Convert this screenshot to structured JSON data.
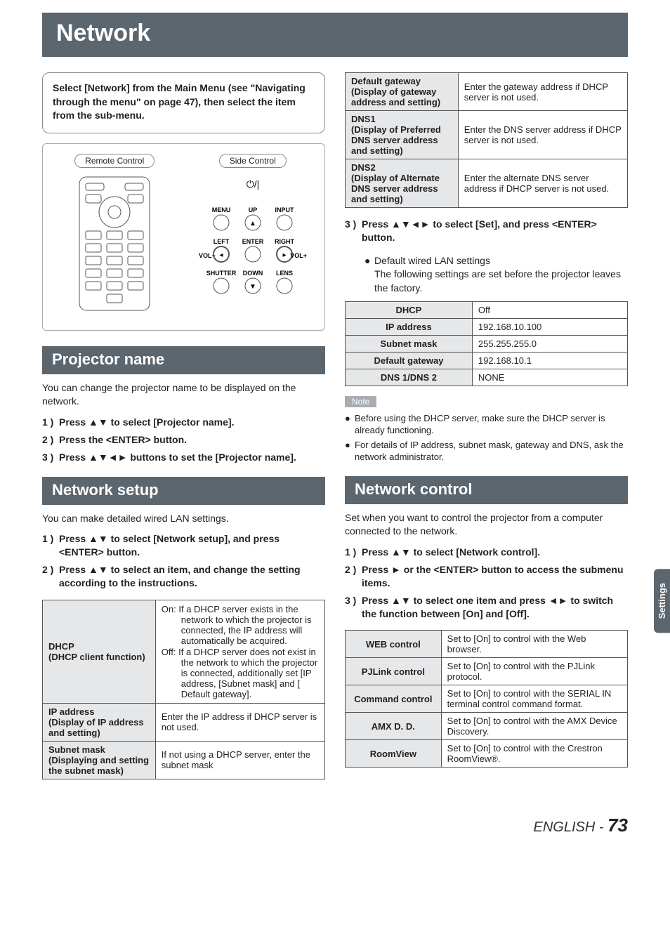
{
  "title": "Network",
  "intro": "Select [Network] from the Main Menu (see \"Navigating through the menu\" on page 47), then select the item from the sub-menu.",
  "diagram": {
    "remote_label": "Remote Control",
    "side_label": "Side Control",
    "side_buttons": [
      "MENU",
      "UP",
      "INPUT",
      "LEFT",
      "ENTER",
      "RIGHT",
      "SHUTTER",
      "DOWN",
      "LENS"
    ],
    "vol_minus": "VOL−",
    "vol_plus": "VOL+",
    "power_icon": "power-standby-icon"
  },
  "sections": {
    "projector_name": {
      "heading": "Projector name",
      "text": "You can change the projector name to be displayed on the network.",
      "steps": [
        "Press ▲▼ to select [Projector name].",
        "Press the <ENTER> button.",
        "Press ▲▼◄► buttons to set the [Projector name]."
      ]
    },
    "network_setup": {
      "heading": "Network setup",
      "text": "You can make detailed wired LAN settings.",
      "steps": [
        "Press ▲▼ to select [Network setup], and press <ENTER> button.",
        "Press ▲▼ to select an item, and change the setting according to the instructions."
      ],
      "table1": [
        {
          "label": "DHCP\n(DHCP client function)",
          "on": "On: If a DHCP server exists in the network to which the projector is connected, the IP address will automatically be acquired.",
          "off": "Off: If a DHCP server does not exist in the network to which the projector is connected, additionally set [IP address, [Subnet mask] and [ Default gateway]."
        },
        {
          "label": "IP address\n(Display of IP address and setting)",
          "desc": "Enter the IP address if DHCP server is not used."
        },
        {
          "label": "Subnet mask\n(Displaying and setting the subnet mask)",
          "desc": "If not using a DHCP server, enter the subnet mask"
        },
        {
          "label": "Default gateway\n(Display of gateway address and setting)",
          "desc": "Enter the gateway address if DHCP server is not used."
        },
        {
          "label": "DNS1\n(Display of Preferred DNS server address and setting)",
          "desc": "Enter the DNS server address if DHCP server is not used."
        },
        {
          "label": "DNS2\n(Display of Alternate DNS server address and setting)",
          "desc": "Enter the alternate DNS server address if DHCP server is not used."
        }
      ],
      "step3": "Press ▲▼◄► to select [Set], and press <ENTER> button.",
      "step3_bullet_title": "Default wired LAN settings",
      "step3_bullet_text": "The following settings are set before the projector leaves the factory.",
      "defaults": [
        {
          "k": "DHCP",
          "v": "Off"
        },
        {
          "k": "IP address",
          "v": "192.168.10.100"
        },
        {
          "k": "Subnet mask",
          "v": "255.255.255.0"
        },
        {
          "k": "Default gateway",
          "v": "192.168.10.1"
        },
        {
          "k": "DNS 1/DNS 2",
          "v": "NONE"
        }
      ],
      "note_label": "Note",
      "notes": [
        "Before using the DHCP server, make sure the DHCP server is already functioning.",
        "For details of IP address, subnet mask, gateway and DNS, ask the network administrator."
      ]
    },
    "network_control": {
      "heading": "Network control",
      "text": "Set when you want to control the projector from a computer connected to the network.",
      "steps": [
        "Press ▲▼ to select [Network control].",
        "Press ► or the <ENTER> button to access the submenu items.",
        "Press ▲▼ to select one item and press ◄► to switch the function between [On] and [Off]."
      ],
      "table": [
        {
          "k": "WEB control",
          "v": "Set to [On] to control with the Web browser."
        },
        {
          "k": "PJLink control",
          "v": "Set to [On] to control with the PJLink protocol."
        },
        {
          "k": "Command control",
          "v": "Set to [On] to control with the SERIAL IN terminal control command format."
        },
        {
          "k": "AMX D. D.",
          "v": "Set to [On] to control with the AMX Device Discovery."
        },
        {
          "k": "RoomView",
          "v": "Set to [On] to control with the Crestron RoomView®."
        }
      ]
    }
  },
  "side_tab": "Settings",
  "footer_lang": "ENGLISH - ",
  "footer_page": "73"
}
